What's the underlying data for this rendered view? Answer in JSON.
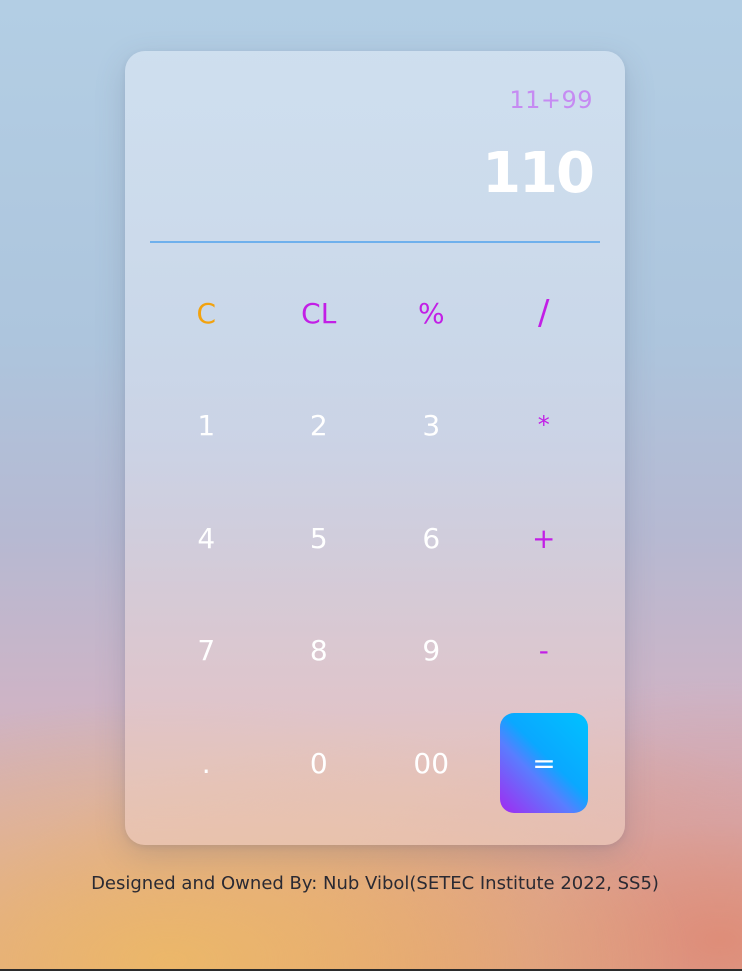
{
  "calculator": {
    "expression": "11+99",
    "result": "110",
    "keys": {
      "clear": "C",
      "clear_last": "CL",
      "percent": "%",
      "divide": "/",
      "one": "1",
      "two": "2",
      "three": "3",
      "multiply": "*",
      "four": "4",
      "five": "5",
      "six": "6",
      "plus": "+",
      "seven": "7",
      "eight": "8",
      "nine": "9",
      "minus": "-",
      "decimal": ".",
      "zero": "0",
      "double_zero": "00",
      "equals": "="
    }
  },
  "footer": {
    "credit": "Designed and Owned By: Nub Vibol(SETEC Institute 2022, SS5)"
  },
  "colors": {
    "operator": "#c21fe6",
    "clear": "#f2a20f",
    "expression": "#c68bf2",
    "divider": "#6fb0ec",
    "equals_gradient_start": "#00c2ff",
    "equals_gradient_end": "#a229f0"
  }
}
